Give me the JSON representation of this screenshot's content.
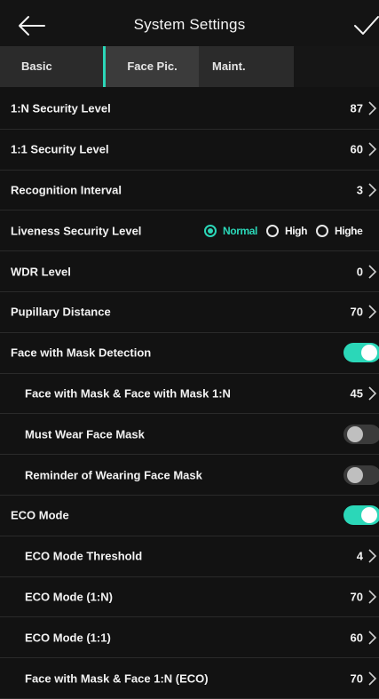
{
  "header": {
    "title": "System Settings"
  },
  "tabs": [
    {
      "label": "Basic",
      "active": false
    },
    {
      "label": "Face Pic.",
      "active": true
    },
    {
      "label": "Maint.",
      "active": false
    }
  ],
  "settings": {
    "one_n_security": {
      "label": "1:N Security Level",
      "value": "87"
    },
    "one_one_security": {
      "label": "1:1 Security Level",
      "value": "60"
    },
    "recognition_interval": {
      "label": "Recognition Interval",
      "value": "3"
    },
    "liveness": {
      "label": "Liveness Security Level",
      "options": [
        "Normal",
        "High",
        "Highe"
      ],
      "selected": "Normal"
    },
    "wdr_level": {
      "label": "WDR Level",
      "value": "0"
    },
    "pupillary_distance": {
      "label": "Pupillary Distance",
      "value": "70"
    },
    "mask_detection": {
      "label": "Face with Mask Detection",
      "enabled": true
    },
    "mask_threshold": {
      "label": "Face with Mask & Face with Mask 1:N",
      "value": "45"
    },
    "must_wear_mask": {
      "label": "Must Wear Face Mask",
      "enabled": false
    },
    "mask_reminder": {
      "label": "Reminder of Wearing Face Mask",
      "enabled": false
    },
    "eco_mode": {
      "label": "ECO Mode",
      "enabled": true
    },
    "eco_threshold": {
      "label": "ECO Mode Threshold",
      "value": "4"
    },
    "eco_one_n": {
      "label": "ECO Mode (1:N)",
      "value": "70"
    },
    "eco_one_one": {
      "label": "ECO Mode (1:1)",
      "value": "60"
    },
    "eco_mask_face": {
      "label": "Face with Mask & Face 1:N (ECO)",
      "value": "70"
    }
  },
  "colors": {
    "accent": "#2bd7b8",
    "background": "#121212",
    "tab_bar": "#2b2b2b"
  },
  "icons": {
    "back": "arrow-left-icon",
    "confirm": "checkmark-icon",
    "chevron": "chevron-right-icon"
  }
}
